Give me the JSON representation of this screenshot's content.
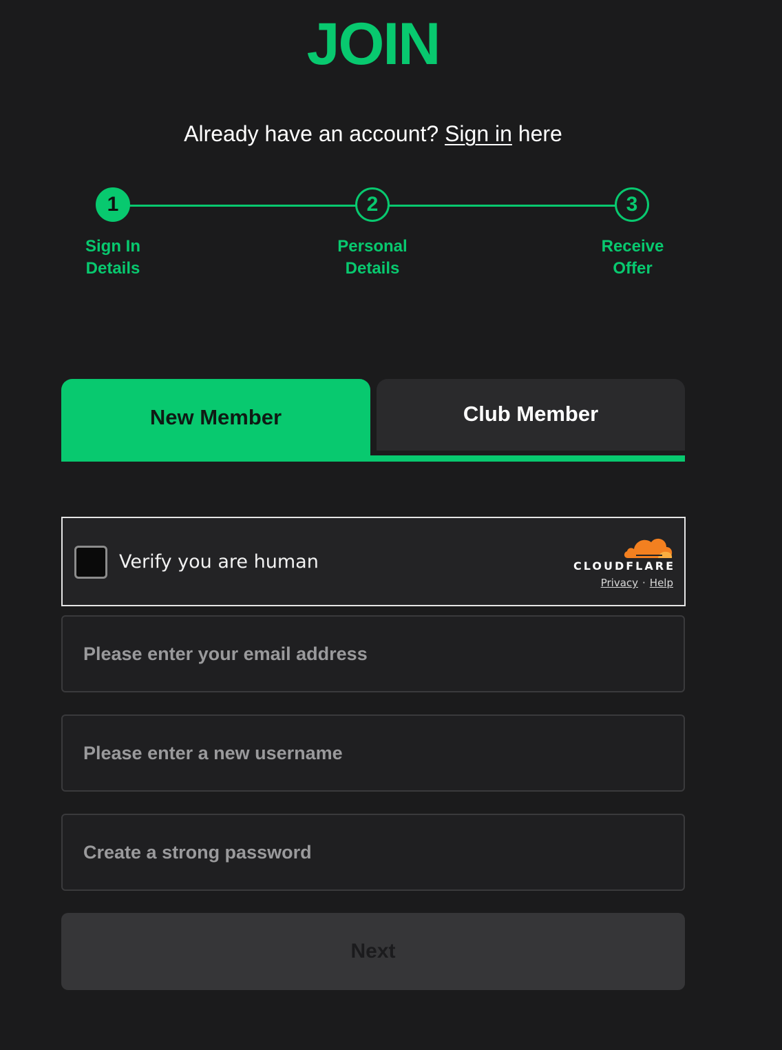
{
  "header": {
    "title": "JOIN",
    "signin_prefix": "Already have an account? ",
    "signin_link": "Sign in",
    "signin_suffix": " here"
  },
  "stepper": {
    "steps": [
      {
        "number": "1",
        "label_line1": "Sign In",
        "label_line2": "Details",
        "active": true
      },
      {
        "number": "2",
        "label_line1": "Personal",
        "label_line2": "Details",
        "active": false
      },
      {
        "number": "3",
        "label_line1": "Receive",
        "label_line2": "Offer",
        "active": false
      }
    ]
  },
  "tabs": {
    "items": [
      {
        "label": "New Member",
        "selected": true
      },
      {
        "label": "Club Member",
        "selected": false
      }
    ]
  },
  "captcha": {
    "text": "Verify you are human",
    "brand": "CLOUDFLARE",
    "privacy_link": "Privacy",
    "separator": "·",
    "help_link": "Help",
    "checked": false
  },
  "form": {
    "email_placeholder": "Please enter your email address",
    "username_placeholder": "Please enter a new username",
    "password_placeholder": "Create a strong password",
    "next_label": "Next"
  },
  "colors": {
    "accent": "#08c96f",
    "background": "#1b1b1c",
    "cloudflare_orange": "#f38020"
  }
}
